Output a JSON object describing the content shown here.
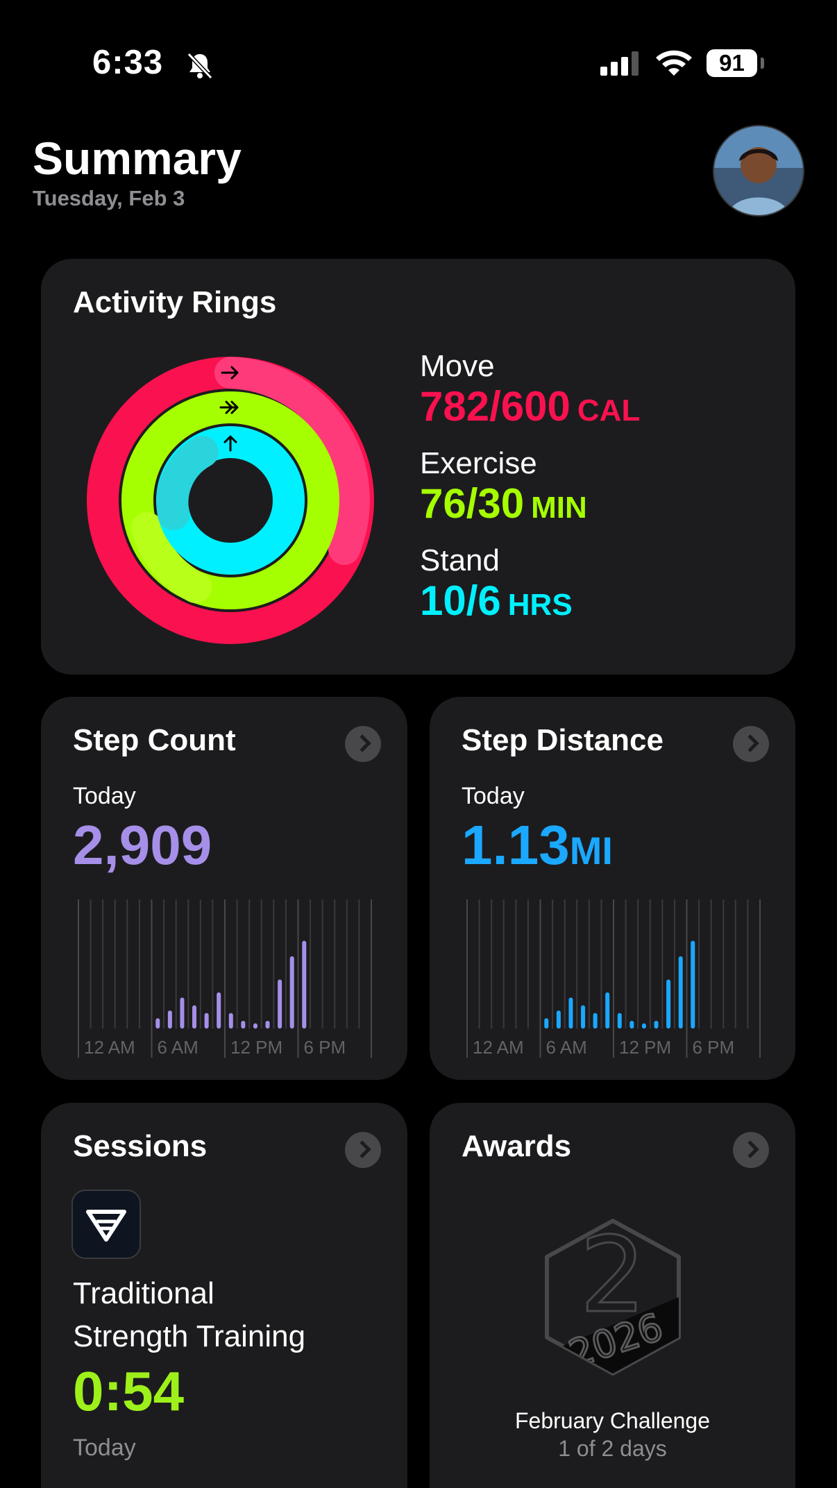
{
  "status_bar": {
    "time": "6:33",
    "battery": "91"
  },
  "header": {
    "title": "Summary",
    "date": "Tuesday, Feb 3"
  },
  "activity": {
    "title": "Activity Rings",
    "move": {
      "label": "Move",
      "value": "782/600",
      "unit": "CAL",
      "color": "#fa114f"
    },
    "exercise": {
      "label": "Exercise",
      "value": "76/30",
      "unit": "MIN",
      "color": "#a6ff00"
    },
    "stand": {
      "label": "Stand",
      "value": "10/6",
      "unit": "HRS",
      "color": "#00f0ff"
    }
  },
  "step_count": {
    "title": "Step Count",
    "period": "Today",
    "value": "2,909",
    "color": "#a68fe8",
    "ticks": [
      "12 AM",
      "6 AM",
      "12 PM",
      "6 PM"
    ],
    "hourly_relative": [
      0,
      0,
      0,
      0,
      0,
      0,
      0.08,
      0.14,
      0.24,
      0.18,
      0.12,
      0.28,
      0.12,
      0.06,
      0.04,
      0.06,
      0.38,
      0.56,
      0.68,
      0,
      0,
      0,
      0,
      0
    ]
  },
  "step_distance": {
    "title": "Step Distance",
    "period": "Today",
    "value": "1.13",
    "unit": "MI",
    "color": "#1ba8ff",
    "ticks": [
      "12 AM",
      "6 AM",
      "12 PM",
      "6 PM"
    ],
    "hourly_relative": [
      0,
      0,
      0,
      0,
      0,
      0,
      0.08,
      0.14,
      0.24,
      0.18,
      0.12,
      0.28,
      0.12,
      0.06,
      0.04,
      0.06,
      0.38,
      0.56,
      0.68,
      0,
      0,
      0,
      0,
      0
    ]
  },
  "sessions": {
    "title": "Sessions",
    "name_line1": "Traditional",
    "name_line2": "Strength Training",
    "duration": "0:54",
    "when": "Today"
  },
  "awards": {
    "title": "Awards",
    "badge_text": "2026",
    "challenge": "February Challenge",
    "progress": "1 of 2 days"
  }
}
